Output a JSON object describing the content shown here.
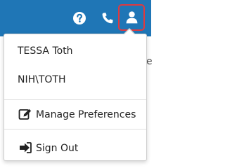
{
  "header": {
    "background_color": "#1f76b6",
    "icons": [
      "help-icon",
      "phone-icon",
      "user-icon"
    ],
    "user_button_highlight_color": "#e0393e"
  },
  "user_menu": {
    "display_name": "TESSA  Toth",
    "login_id": "NIH\\TOTH",
    "items": [
      {
        "label": "Manage Preferences",
        "icon": "edit-icon"
      },
      {
        "label": "Sign Out",
        "icon": "sign-out-icon"
      }
    ]
  },
  "background_peek_text": "e"
}
